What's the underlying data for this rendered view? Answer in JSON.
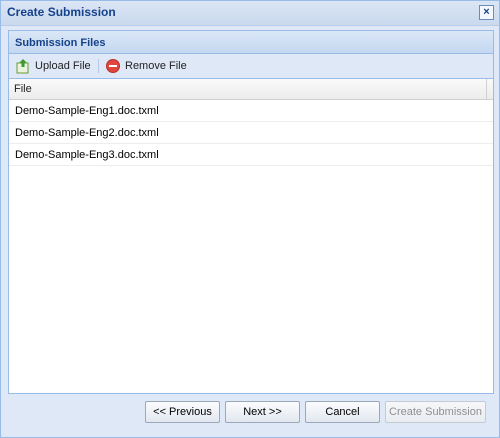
{
  "window": {
    "title": "Create Submission"
  },
  "panel": {
    "title": "Submission Files"
  },
  "toolbar": {
    "upload_label": "Upload File",
    "remove_label": "Remove File"
  },
  "grid": {
    "columns": [
      "File"
    ],
    "rows": [
      "Demo-Sample-Eng1.doc.txml",
      "Demo-Sample-Eng2.doc.txml",
      "Demo-Sample-Eng3.doc.txml"
    ]
  },
  "buttons": {
    "previous": "<< Previous",
    "next": "Next >>",
    "cancel": "Cancel",
    "create": "Create Submission"
  },
  "colors": {
    "title_text": "#15428b",
    "panel_border": "#99bbe8"
  }
}
